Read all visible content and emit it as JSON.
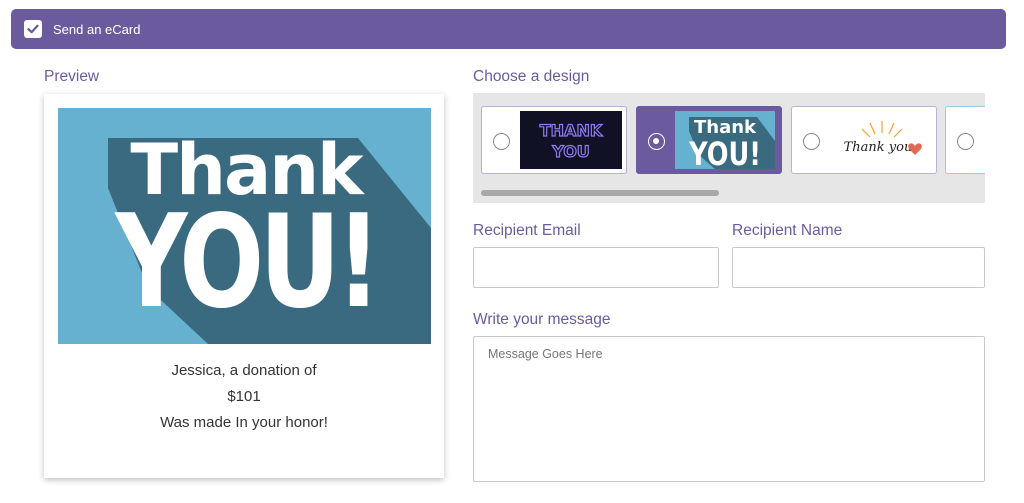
{
  "ecard_toggle": {
    "label": "Send an eCard",
    "checked": true
  },
  "preview": {
    "heading": "Preview",
    "image_text_line1": "Thank",
    "image_text_line2": "YOU!",
    "message_line1": "Jessica, a donation of",
    "message_amount": "$101",
    "message_line3": "Was made In your honor!"
  },
  "designs": {
    "heading": "Choose a design",
    "options": [
      {
        "text_line1": "THANK",
        "text_line2": "YOU",
        "selected": false
      },
      {
        "text_line1": "Thank",
        "text_line2": "YOU!",
        "selected": true
      },
      {
        "text_line1": "Thank you",
        "selected": false
      },
      {
        "selected": false
      }
    ]
  },
  "form": {
    "recipient_email_label": "Recipient Email",
    "recipient_name_label": "Recipient Name",
    "message_label": "Write your message",
    "message_placeholder": "Message Goes Here"
  },
  "colors": {
    "accent": "#6b5b9e",
    "card_blue": "#66b1cf",
    "card_shadow": "#3a6a80"
  }
}
